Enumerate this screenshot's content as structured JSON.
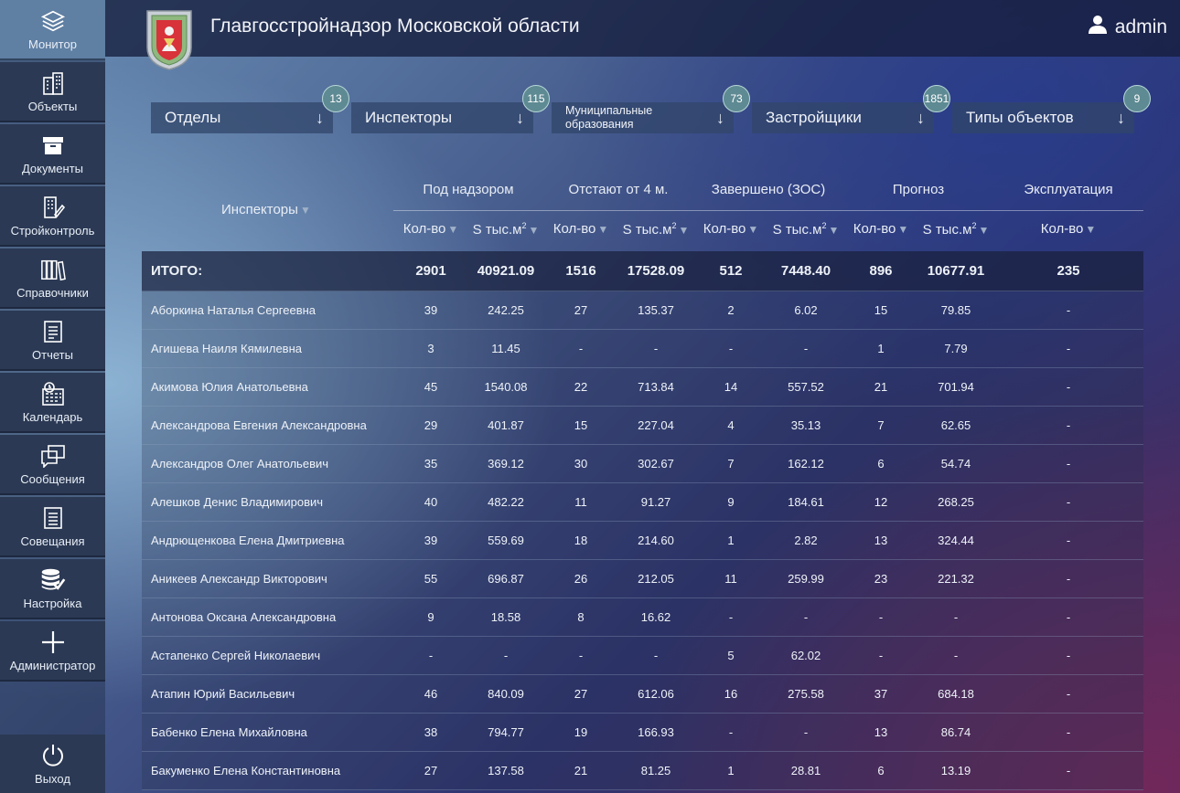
{
  "header": {
    "title": "Главгосстройнадзор Московской области",
    "user": "admin"
  },
  "sidebar": {
    "items": [
      {
        "label": "Монитор",
        "icon": "layers-icon",
        "active": true
      },
      {
        "label": "Объекты",
        "icon": "buildings-icon"
      },
      {
        "label": "Документы",
        "icon": "archive-box-icon"
      },
      {
        "label": "Стройконтроль",
        "icon": "building-edit-icon"
      },
      {
        "label": "Справочники",
        "icon": "books-icon"
      },
      {
        "label": "Отчеты",
        "icon": "report-icon"
      },
      {
        "label": "Календарь",
        "icon": "calendar-clock-icon"
      },
      {
        "label": "Сообщения",
        "icon": "chat-icon"
      },
      {
        "label": "Совещания",
        "icon": "meeting-list-icon"
      },
      {
        "label": "Настройка",
        "icon": "database-check-icon"
      },
      {
        "label": "Администратор",
        "icon": "plus-icon"
      }
    ],
    "logout": {
      "label": "Выход",
      "icon": "power-icon"
    }
  },
  "filters": [
    {
      "label": "Отделы",
      "count": "13"
    },
    {
      "label": "Инспекторы",
      "count": "115"
    },
    {
      "label": "Муниципальные образования",
      "count": "73"
    },
    {
      "label": "Застройщики",
      "count": "1851"
    },
    {
      "label": "Типы объектов",
      "count": "9"
    }
  ],
  "table": {
    "col_inspectors": "Инспекторы",
    "groups": [
      "Под надзором",
      "Отстают от 4 м.",
      "Завершено (ЗОС)",
      "Прогноз",
      "Эксплуатация"
    ],
    "sub_count": "Кол-во",
    "sub_area": "S тыс.м",
    "sup": "2",
    "total": {
      "name": "ИТОГО:",
      "values": [
        "2901",
        "40921.09",
        "1516",
        "17528.09",
        "512",
        "7448.40",
        "896",
        "10677.91",
        "235"
      ]
    },
    "rows": [
      {
        "name": "Аборкина Наталья Сергеевна",
        "values": [
          "39",
          "242.25",
          "27",
          "135.37",
          "2",
          "6.02",
          "15",
          "79.85",
          "-"
        ]
      },
      {
        "name": "Агишева Наиля Кямилевна",
        "values": [
          "3",
          "11.45",
          "-",
          "-",
          "-",
          "-",
          "1",
          "7.79",
          "-"
        ]
      },
      {
        "name": "Акимова Юлия Анатольевна",
        "values": [
          "45",
          "1540.08",
          "22",
          "713.84",
          "14",
          "557.52",
          "21",
          "701.94",
          "-"
        ]
      },
      {
        "name": "Александрова Евгения Александровна",
        "values": [
          "29",
          "401.87",
          "15",
          "227.04",
          "4",
          "35.13",
          "7",
          "62.65",
          "-"
        ]
      },
      {
        "name": "Александров Олег Анатольевич",
        "values": [
          "35",
          "369.12",
          "30",
          "302.67",
          "7",
          "162.12",
          "6",
          "54.74",
          "-"
        ]
      },
      {
        "name": "Алешков Денис Владимирович",
        "values": [
          "40",
          "482.22",
          "11",
          "91.27",
          "9",
          "184.61",
          "12",
          "268.25",
          "-"
        ]
      },
      {
        "name": "Андрющенкова Елена Дмитриевна",
        "values": [
          "39",
          "559.69",
          "18",
          "214.60",
          "1",
          "2.82",
          "13",
          "324.44",
          "-"
        ]
      },
      {
        "name": "Аникеев Александр Викторович",
        "values": [
          "55",
          "696.87",
          "26",
          "212.05",
          "11",
          "259.99",
          "23",
          "221.32",
          "-"
        ]
      },
      {
        "name": "Антонова Оксана Александровна",
        "values": [
          "9",
          "18.58",
          "8",
          "16.62",
          "-",
          "-",
          "-",
          "-",
          "-"
        ]
      },
      {
        "name": "Астапенко Сергей Николаевич",
        "values": [
          "-",
          "-",
          "-",
          "-",
          "5",
          "62.02",
          "-",
          "-",
          "-"
        ]
      },
      {
        "name": "Атапин Юрий Васильевич",
        "values": [
          "46",
          "840.09",
          "27",
          "612.06",
          "16",
          "275.58",
          "37",
          "684.18",
          "-"
        ]
      },
      {
        "name": "Бабенко Елена Михайловна",
        "values": [
          "38",
          "794.77",
          "19",
          "166.93",
          "-",
          "-",
          "13",
          "86.74",
          "-"
        ]
      },
      {
        "name": "Бакуменко Елена Константиновна",
        "values": [
          "27",
          "137.58",
          "21",
          "81.25",
          "1",
          "28.81",
          "6",
          "13.19",
          "-"
        ]
      }
    ]
  }
}
